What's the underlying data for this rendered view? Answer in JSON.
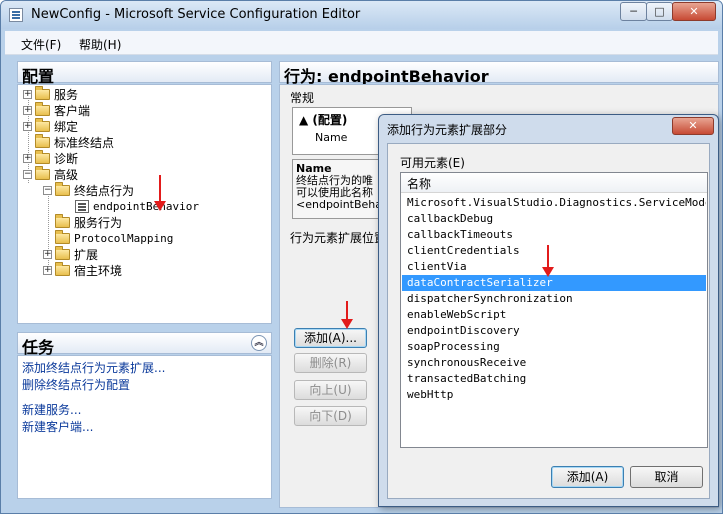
{
  "window": {
    "title": "NewConfig - Microsoft Service Configuration Editor"
  },
  "caption": {
    "minimize": "─",
    "maximize": "□",
    "close": "✕"
  },
  "menu": [
    {
      "label": "文件(F)"
    },
    {
      "label": "帮助(H)"
    }
  ],
  "config": {
    "title": "配置",
    "tree": [
      {
        "label": "服务",
        "expander": "+",
        "icon": "folder-icon"
      },
      {
        "label": "客户端",
        "expander": "+",
        "icon": "folder-icon"
      },
      {
        "label": "绑定",
        "expander": "+",
        "icon": "folder-icon"
      },
      {
        "label": "标准终结点",
        "expander": "",
        "icon": "folder-icon"
      },
      {
        "label": "诊断",
        "expander": "+",
        "icon": "folder-icon"
      },
      {
        "label": "高级",
        "expander": "−",
        "icon": "folder-icon"
      },
      {
        "label": "终结点行为",
        "expander": "−",
        "icon": "folder-icon"
      },
      {
        "label": "endpointBehavior",
        "expander": "",
        "icon": "node-icon"
      },
      {
        "label": "服务行为",
        "expander": "",
        "icon": "folder-icon"
      },
      {
        "label": "ProtocolMapping",
        "expander": "",
        "icon": "folder-icon"
      },
      {
        "label": "扩展",
        "expander": "+",
        "icon": "folder-icon"
      },
      {
        "label": "宿主环境",
        "expander": "+",
        "icon": "folder-icon"
      }
    ]
  },
  "tasks": {
    "title": "任务",
    "collapse": "︽",
    "links": [
      {
        "label": "添加终结点行为元素扩展..."
      },
      {
        "label": "删除终结点行为配置"
      },
      {
        "label": "新建服务..."
      },
      {
        "label": "新建客户端..."
      }
    ]
  },
  "behavior": {
    "title": "行为: endpointBehavior",
    "general": "常规",
    "category": "(配置)",
    "grid_name": "Name",
    "desc_name": "Name",
    "desc_line1": "终结点行为的唯",
    "desc_line2": "可以使用此名称",
    "desc_line3": "<endpointBehav",
    "ext_label": "行为元素扩展位置",
    "buttons": {
      "add": "添加(A)...",
      "delete": "删除(R)",
      "up": "向上(U)",
      "down": "向下(D)"
    }
  },
  "dialog": {
    "title": "添加行为元素扩展部分",
    "close": "✕",
    "available_label": "可用元素(E)",
    "column": "名称",
    "items": [
      "Microsoft.VisualStudio.Diagnostics.ServiceModelSink",
      "callbackDebug",
      "callbackTimeouts",
      "clientCredentials",
      "clientVia",
      "dataContractSerializer",
      "dispatcherSynchronization",
      "enableWebScript",
      "endpointDiscovery",
      "soapProcessing",
      "synchronousReceive",
      "transactedBatching",
      "webHttp"
    ],
    "selected": "dataContractSerializer",
    "add": "添加(A)",
    "cancel": "取消"
  },
  "colors": {
    "selection": "#3399ff",
    "arrow": "#e21b1b",
    "link": "#0b3a9b"
  }
}
